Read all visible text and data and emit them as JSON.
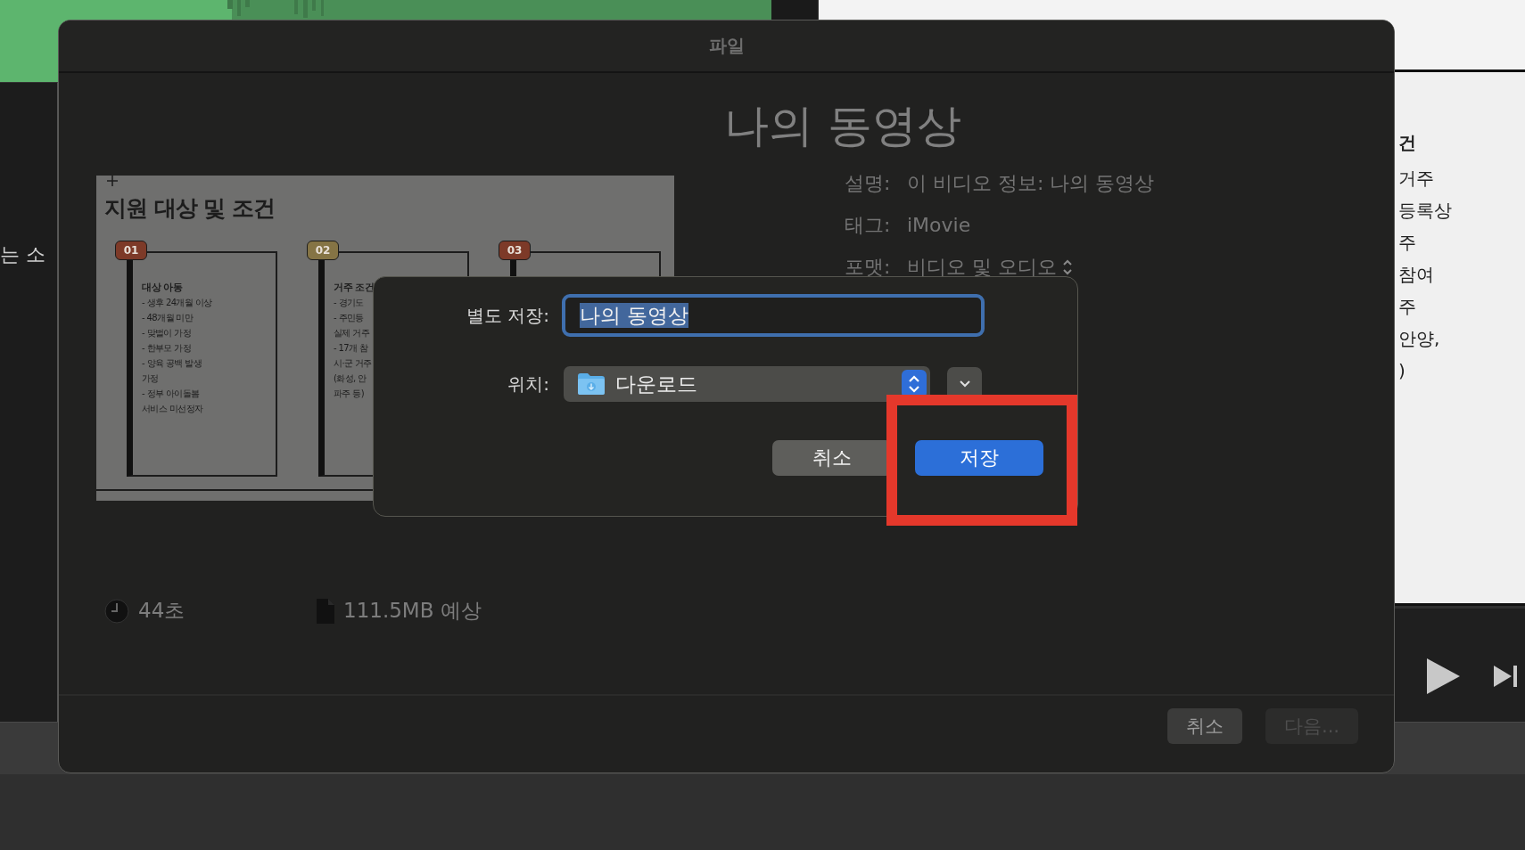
{
  "background": {
    "timeline_text": "는 소",
    "document_lines": [
      {
        "text": "건",
        "kind": "heading"
      },
      {
        "text": "거주",
        "kind": "text"
      },
      {
        "text": "등록상",
        "kind": "text"
      },
      {
        "text": "주",
        "kind": "text"
      },
      {
        "text": "참여",
        "kind": "text"
      },
      {
        "text": "주",
        "kind": "text"
      },
      {
        "text": "안양,",
        "kind": "text"
      },
      {
        "text": ")",
        "kind": "text"
      }
    ]
  },
  "sheet": {
    "title": "파일",
    "video_title": "나의 동영상",
    "fields": [
      {
        "label": "설명:",
        "value": "이 비디오 정보: 나의 동영상",
        "kind": "text"
      },
      {
        "label": "태그:",
        "value": "iMovie",
        "kind": "text"
      },
      {
        "label": "포맷:",
        "value": "비디오 및 오디오",
        "kind": "popup"
      }
    ],
    "thumbnail": {
      "title": "지원 대상 및 조건",
      "cards": [
        {
          "number": "01",
          "color": "#7d3a28",
          "heading": "대상 아동",
          "lines": [
            "- 생후 24개월 이상",
            "- 48개월 미만",
            "- 맞벌이 가정",
            "- 한부모 가정",
            "- 양육 공백 발생",
            "가정",
            "- 정부 아이돌봄",
            "서비스 미선정자"
          ]
        },
        {
          "number": "02",
          "color": "#857445",
          "heading": "거주 조건",
          "lines": [
            "- 경기도",
            "- 주민등",
            "실제 거주",
            "- 17개 참",
            "시·군 거주",
            "(화성, 안",
            "파주 등)"
          ]
        },
        {
          "number": "03",
          "color": "#7d3a28"
        }
      ]
    },
    "duration": "44초",
    "file_size": "111.5MB 예상",
    "buttons": [
      {
        "label": "취소",
        "disabled": false
      },
      {
        "label": "다음...",
        "disabled": true
      }
    ]
  },
  "save_dialog": {
    "save_as_label": "별도 저장:",
    "filename": "나의 동영상",
    "filename_selected": true,
    "location_label": "위치:",
    "location": "다운로드",
    "buttons": [
      {
        "label": "취소",
        "kind": "secondary"
      },
      {
        "label": "저장",
        "kind": "default"
      }
    ]
  }
}
